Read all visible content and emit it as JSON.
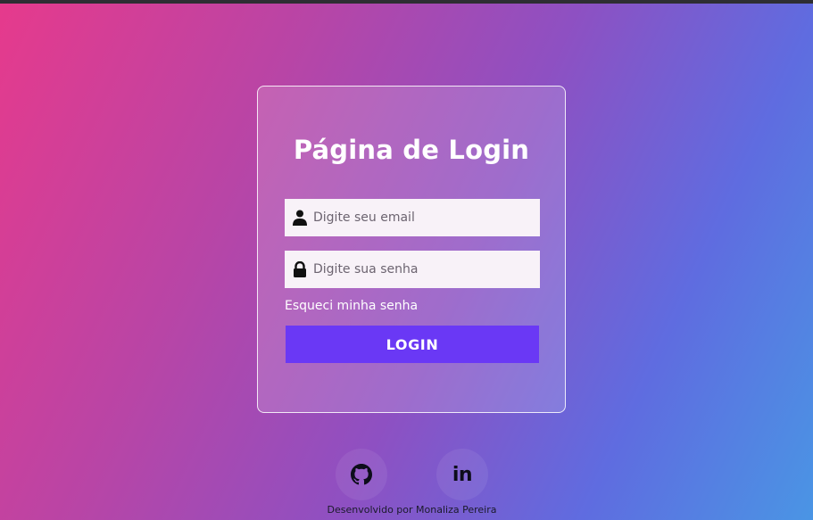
{
  "card": {
    "title": "Página de Login"
  },
  "form": {
    "email_placeholder": "Digite seu email",
    "email_value": "",
    "password_placeholder": "Digite sua senha",
    "password_value": "",
    "forgot_link": "Esqueci minha senha",
    "login_button": "LOGIN"
  },
  "social": {
    "github_icon": "github-icon",
    "linkedin_label": "in"
  },
  "footer": {
    "credit": "Desenvolvido por Monaliza Pereira"
  },
  "colors": {
    "login_button": "#6a38f5",
    "gradient_start": "#e63a8c",
    "gradient_end": "#4a95e4"
  }
}
